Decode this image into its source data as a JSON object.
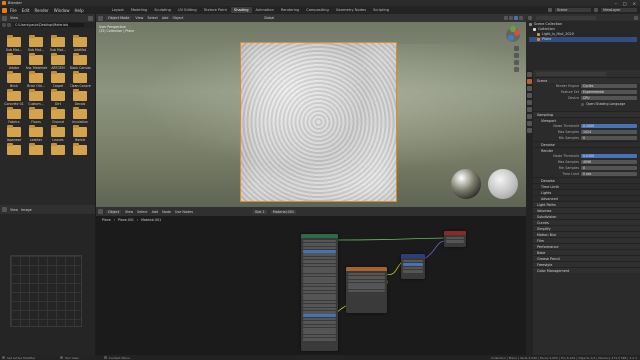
{
  "window": {
    "title": "Blender",
    "right_label": "Scene",
    "view_layer": "ViewLayer"
  },
  "menus": [
    "File",
    "Edit",
    "Render",
    "Window",
    "Help"
  ],
  "workspaces": [
    "Layout",
    "Modeling",
    "Sculpting",
    "UV Editing",
    "Texture Paint",
    "Shading",
    "Animation",
    "Rendering",
    "Compositing",
    "Geometry Nodes",
    "Scripting"
  ],
  "active_workspace": "Shading",
  "file_browser": {
    "path": "C:\\Users\\paulo\\Desktop\\Materials",
    "folders": [
      "Sub Mat...",
      "Sub Mat...",
      "Sub Mat...",
      "AddMat",
      "Adobe",
      "Arq. Materials",
      "ARTGEM",
      "Black Canvas",
      "Brick",
      "Brick Old...",
      "Carpet",
      "Clean Concrete",
      "Concrete 01",
      "Custom...",
      "Dirt",
      "Decals",
      "Fabrics",
      "Floors",
      "Ground",
      "Insulation",
      "Japanese",
      "Leather",
      "Leaves",
      "Marble",
      "",
      "",
      "",
      ""
    ]
  },
  "viewport": {
    "mode": "Object Mode",
    "menus": [
      "View",
      "Select",
      "Add",
      "Object"
    ],
    "shading_label": "Global",
    "info_line1": "User Perspective",
    "info_line2": "(35) Collection | Plane",
    "popup_label": "Shading"
  },
  "node_editor": {
    "mode": "Object",
    "menus": [
      "View",
      "Select",
      "Add",
      "Node"
    ],
    "use_nodes": "Use Nodes",
    "slot": "Slot 1",
    "material": "Material.001",
    "breadcrumb": [
      "Plane",
      "Plane.001",
      "Material.001"
    ],
    "nodes": [
      {
        "title": "Principled BSDF",
        "color": "#2d6b46"
      },
      {
        "title": "Material Output",
        "color": "#8a2a2a"
      },
      {
        "title": "Image Texture",
        "color": "#7a4e23"
      },
      {
        "title": "Displacement",
        "color": "#2d3f7a"
      }
    ]
  },
  "outliner": {
    "title": "Scene Collection",
    "items": [
      "Collection",
      "Light_is_Hiut_2020",
      "Plane"
    ]
  },
  "properties": {
    "section": "Scene",
    "render_engine_label": "Render Engine",
    "render_engine": "Cycles",
    "feature_set_label": "Feature Set",
    "feature_set": "Experimental",
    "device_label": "Device",
    "device": "CPU",
    "osl_label": "Open Shading Language",
    "panels": [
      "Sampling",
      "Viewport",
      "Noise Threshold",
      "Max Samples",
      "Min Samples",
      "Denoise",
      "Render",
      "Noise Threshold",
      "Max Samples",
      "Min Samples",
      "Time Limit",
      "Advanced",
      "Light Paths",
      "Volumes",
      "Subdivision",
      "Curves",
      "Simplify",
      "Motion Blur",
      "Film",
      "Performance",
      "Bake",
      "Grease Pencil",
      "Freestyle",
      "Color Management"
    ],
    "values": {
      "viewport_noise": "0.1000",
      "viewport_max": "1024",
      "viewport_min": "0",
      "render_noise": "0.0100",
      "render_max": "4096",
      "render_min": "0",
      "time_limit": "0 sec"
    },
    "checkbox_items": [
      "Denoise",
      "Time Limit",
      "Lights",
      "Advanced"
    ]
  },
  "status": {
    "left": "Set Active Modifier",
    "mid1": "Pan View",
    "mid2": "Context Menu",
    "right": "Collection | Plane | Verts 4,096 | Faces 4,050 | Tris 8,100 | Objects 1/2 | Memory 271.5 MiB | 3.2.1"
  }
}
